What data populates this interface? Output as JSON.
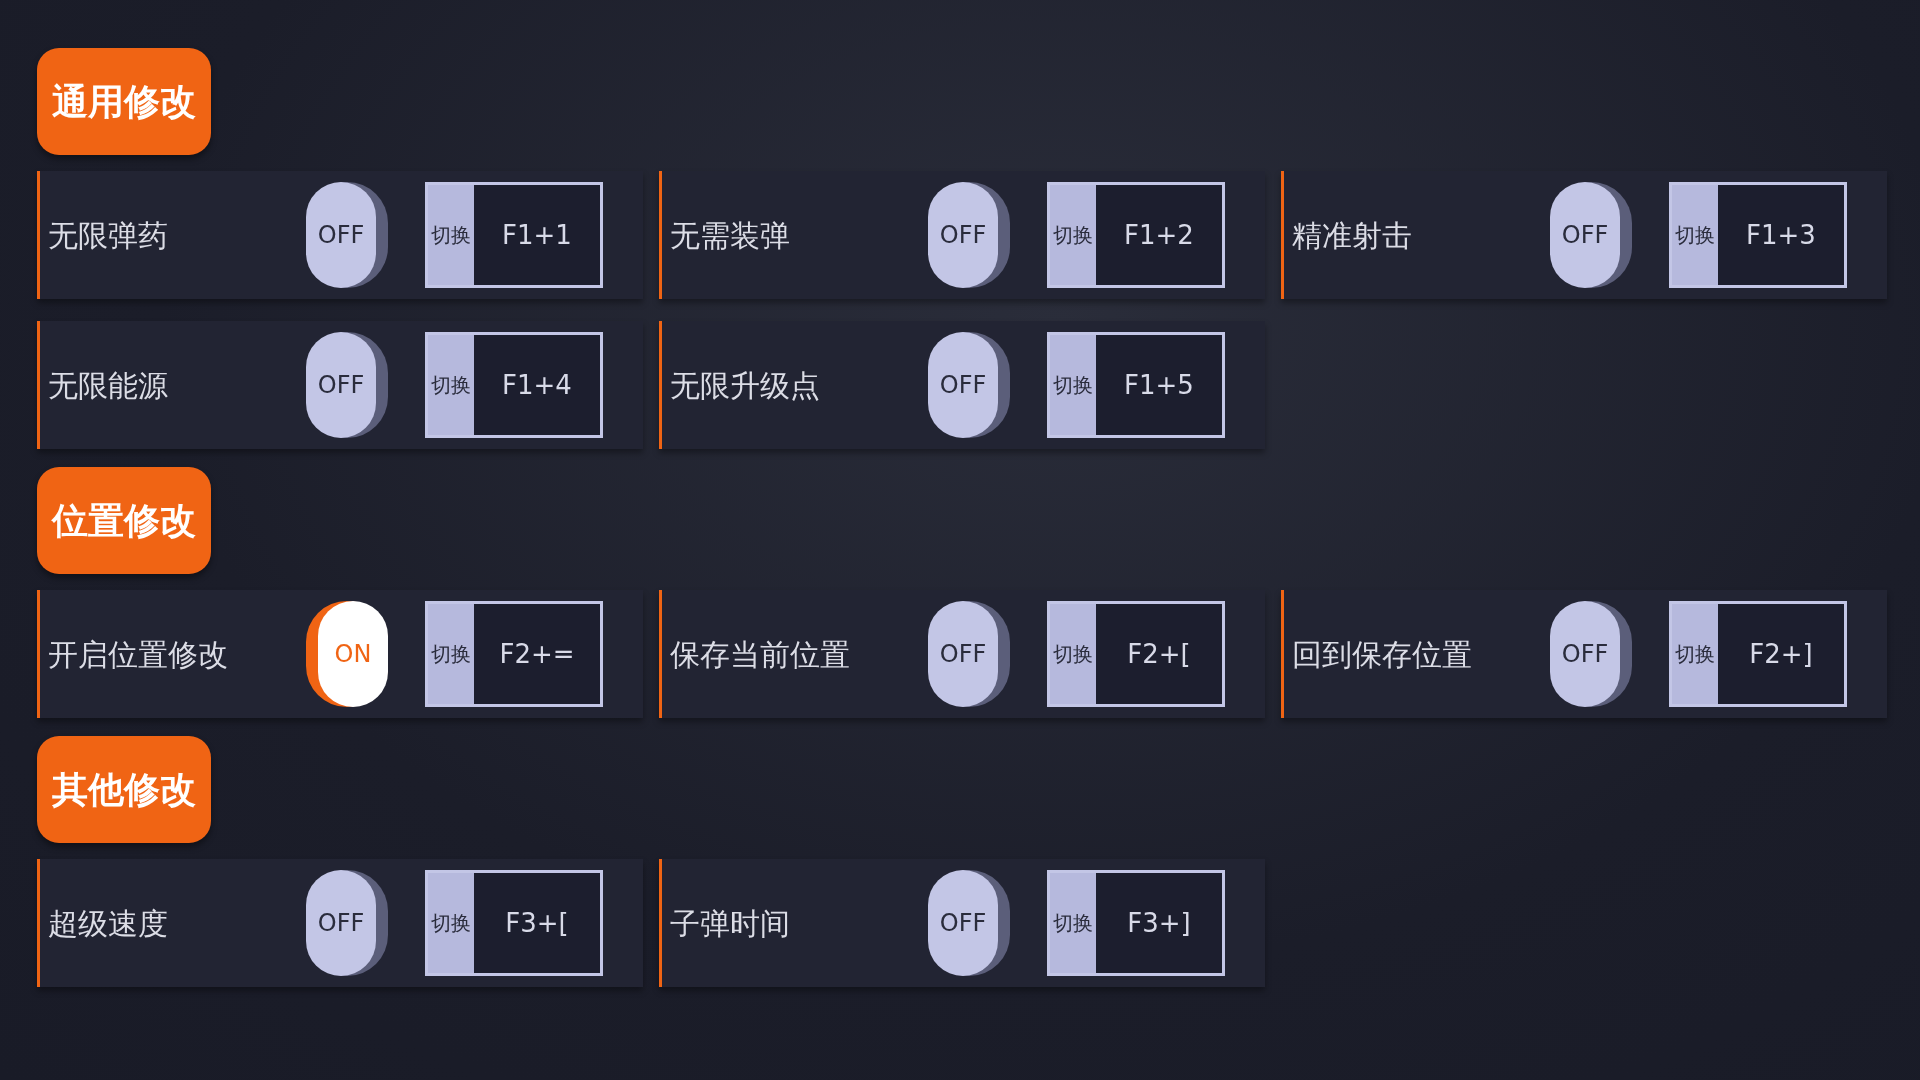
{
  "sections": [
    {
      "title": "通用修改",
      "items": [
        {
          "label": "无限弹药",
          "on": false,
          "toggle_text": "OFF",
          "key_label": "切换",
          "hotkey": "F1+1"
        },
        {
          "label": "无需装弹",
          "on": false,
          "toggle_text": "OFF",
          "key_label": "切换",
          "hotkey": "F1+2"
        },
        {
          "label": "精准射击",
          "on": false,
          "toggle_text": "OFF",
          "key_label": "切换",
          "hotkey": "F1+3"
        },
        {
          "label": "无限能源",
          "on": false,
          "toggle_text": "OFF",
          "key_label": "切换",
          "hotkey": "F1+4"
        },
        {
          "label": "无限升级点",
          "on": false,
          "toggle_text": "OFF",
          "key_label": "切换",
          "hotkey": "F1+5"
        }
      ]
    },
    {
      "title": "位置修改",
      "items": [
        {
          "label": "开启位置修改",
          "on": true,
          "toggle_text": "ON",
          "key_label": "切换",
          "hotkey": "F2+="
        },
        {
          "label": "保存当前位置",
          "on": false,
          "toggle_text": "OFF",
          "key_label": "切换",
          "hotkey": "F2+["
        },
        {
          "label": "回到保存位置",
          "on": false,
          "toggle_text": "OFF",
          "key_label": "切换",
          "hotkey": "F2+]"
        }
      ]
    },
    {
      "title": "其他修改",
      "items": [
        {
          "label": "超级速度",
          "on": false,
          "toggle_text": "OFF",
          "key_label": "切换",
          "hotkey": "F3+["
        },
        {
          "label": "子弹时间",
          "on": false,
          "toggle_text": "OFF",
          "key_label": "切换",
          "hotkey": "F3+]"
        }
      ]
    }
  ]
}
